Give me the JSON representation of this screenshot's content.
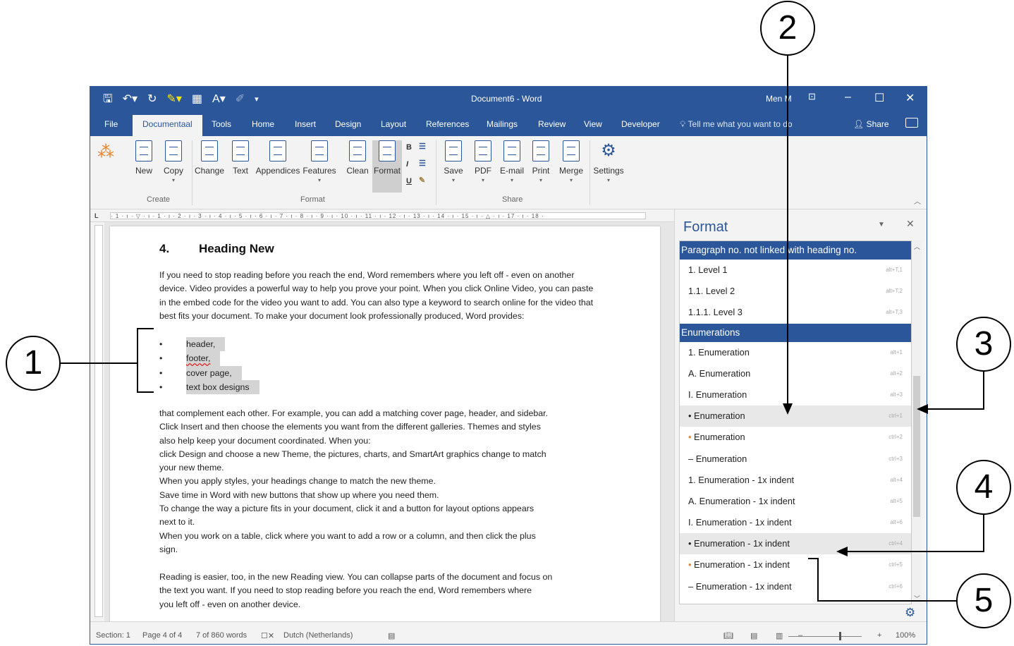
{
  "window": {
    "title": "Document6  -  Word",
    "user": "Men M",
    "qat_icons": [
      "save-icon",
      "undo-icon",
      "redo-icon",
      "highlight-icon",
      "table-icon",
      "spelling-icon",
      "format-painter-icon",
      "customize-icon"
    ]
  },
  "tabs": [
    "File",
    "Documentaal",
    "Tools",
    "Home",
    "Insert",
    "Design",
    "Layout",
    "References",
    "Mailings",
    "Review",
    "View",
    "Developer"
  ],
  "tell_me": "Tell me what you want to do",
  "share": "Share",
  "ribbon": {
    "create": {
      "label": "Create",
      "buttons": [
        "New",
        "Copy"
      ]
    },
    "format": {
      "label": "Format",
      "buttons": [
        "Change",
        "Text",
        "Appendices",
        "Features",
        "Clean",
        "Format"
      ],
      "mini": [
        "B",
        "I",
        "U"
      ]
    },
    "share": {
      "label": "Share",
      "buttons": [
        "Save",
        "PDF",
        "E-mail",
        "Print",
        "Merge"
      ]
    },
    "settings": "Settings"
  },
  "ruler_text": "· 1 · ı · ▽ · ı · 1 · ı · 2 · ı · 3 · ı · 4 · ı · 5 · ı · 6 · ı · 7 · ı · 8 · ı · 9 · ı · 10 · ı · 11 · ı · 12 · ı · 13 · ı · 14 · ı · 15 · ı · △ · ı · 17 · ı · 18 ·",
  "document": {
    "heading_number": "4.",
    "heading": "Heading New",
    "para1": "If you need to stop reading before you reach the end, Word remembers where you left off - even on another device. Video provides a powerful way to help you prove your point. When you click Online Video, you can paste in the embed code for the video you want to add. You can also type a keyword to search online for the video that best fits your document. To make your document look professionally produced, Word provides:",
    "bullets": [
      "header,",
      "footer,",
      "cover page,",
      "text box designs"
    ],
    "bullet_char": "•",
    "para2_lines": [
      "that complement each other. For example, you can add a matching cover page, header, and sidebar.",
      "Click Insert and then choose the elements you want from the different galleries. Themes and styles",
      "also help keep your document coordinated. When you:",
      "click Design and choose a new Theme, the pictures, charts, and SmartArt graphics change to match",
      "your new theme.",
      "When you apply styles, your headings change to match the new theme.",
      "Save time in Word with new buttons that show up where you need them.",
      "To change the way a picture fits in your document, click it and a button for layout options appears",
      "next to it.",
      "When you work on a table, click where you want to add a row or a column, and then click the plus",
      "sign."
    ],
    "para3_lines": [
      "Reading is easier, too, in the new Reading view. You can collapse parts of the document and focus on",
      "the text you want. If you need to stop reading before you reach the end, Word remembers where",
      "you left off - even on another device."
    ]
  },
  "format_pane": {
    "title": "Format",
    "section1": "Paragraph no. not linked with heading no.",
    "section1_items": [
      {
        "label": "1.  Level 1",
        "shortcut": "alt+T,1"
      },
      {
        "label": "1.1.  Level 2",
        "shortcut": "alt+T,2"
      },
      {
        "label": "1.1.1.  Level 3",
        "shortcut": "alt+T,3"
      }
    ],
    "section2": "Enumerations",
    "section2_items": [
      {
        "prefix": "1.",
        "label": "Enumeration",
        "shortcut": "alt+1"
      },
      {
        "prefix": "A.",
        "label": "Enumeration",
        "shortcut": "alt+2"
      },
      {
        "prefix": "I.",
        "label": "Enumeration",
        "shortcut": "alt+3"
      },
      {
        "prefix": "•",
        "label": "Enumeration",
        "shortcut": "ctrl+1"
      },
      {
        "prefix": "•",
        "label": "Enumeration",
        "shortcut": "ctrl+2"
      },
      {
        "prefix": "–",
        "label": "Enumeration",
        "shortcut": "ctrl+3"
      },
      {
        "prefix": "1.",
        "label": "Enumeration - 1x indent",
        "shortcut": "alt+4"
      },
      {
        "prefix": "A.",
        "label": "Enumeration - 1x indent",
        "shortcut": "alt+5"
      },
      {
        "prefix": "I.",
        "label": "Enumeration - 1x indent",
        "shortcut": "alt+6"
      },
      {
        "prefix": "•",
        "label": "Enumeration - 1x indent",
        "shortcut": "ctrl+4"
      },
      {
        "prefix": "•",
        "label": "Enumeration - 1x indent",
        "shortcut": "ctrl+5"
      },
      {
        "prefix": "–",
        "label": "Enumeration - 1x indent",
        "shortcut": "ctrl+6"
      }
    ]
  },
  "status": {
    "section": "Section: 1",
    "page": "Page 4 of 4",
    "words": "7 of 860 words",
    "language": "Dutch (Netherlands)",
    "zoom": "100%"
  },
  "callouts": [
    "1",
    "2",
    "3",
    "4",
    "5"
  ],
  "colors": {
    "word_blue": "#2b579a",
    "selection_gray": "#d4d4d4",
    "orange_bullet": "#e8852b"
  }
}
